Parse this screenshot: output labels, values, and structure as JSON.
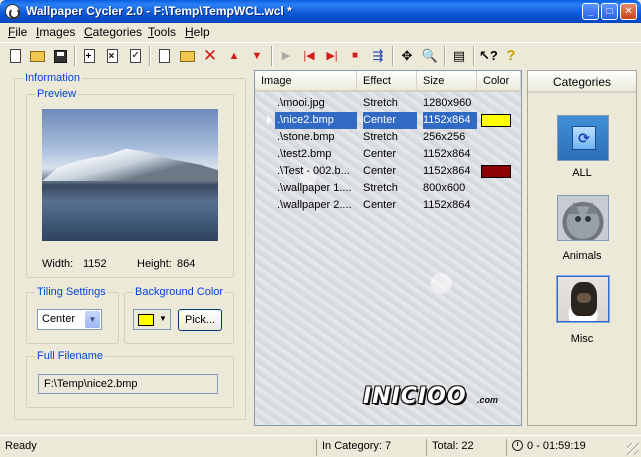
{
  "window": {
    "title": "Wallpaper Cycler 2.0 - F:\\Temp\\TempWCL.wcl *",
    "min": "_",
    "max": "□",
    "close": "✕"
  },
  "menu": {
    "file": {
      "u": "F",
      "rest": "ile"
    },
    "images": {
      "u": "I",
      "rest": "mages"
    },
    "categories": {
      "u": "C",
      "rest": "ategories"
    },
    "tools": {
      "u": "T",
      "rest": "ools"
    },
    "help": {
      "u": "H",
      "rest": "elp"
    }
  },
  "toolbar": {
    "icons": [
      "new-doc",
      "open-folder",
      "save-disk",
      "add-image",
      "delete-image",
      "checklist",
      "new-category",
      "add-folder",
      "delete-x",
      "move-up",
      "move-down",
      "play",
      "first",
      "last",
      "stop",
      "export",
      "settings",
      "preview",
      "properties",
      "context-help",
      "help"
    ]
  },
  "info": {
    "group_label": "Information",
    "preview_label": "Preview",
    "width_label": "Width:",
    "width_value": "1152",
    "height_label": "Height:",
    "height_value": "864",
    "tiling_label": "Tiling Settings",
    "tiling_value": "Center",
    "bg_color_label": "Background Color",
    "bg_color": "#ffff00",
    "pick_label": "Pick...",
    "filename_label": "Full Filename",
    "filename_value": "F:\\Temp\\nice2.bmp"
  },
  "image_list": {
    "columns": [
      "Image",
      "Effect",
      "Size",
      "Color"
    ],
    "rows": [
      {
        "image": ".\\mooi.jpg",
        "effect": "Stretch",
        "size": "1280x960",
        "color": null
      },
      {
        "image": ".\\nice2.bmp",
        "effect": "Center",
        "size": "1152x864",
        "color": "#ffff00",
        "selected": true
      },
      {
        "image": ".\\stone.bmp",
        "effect": "Stretch",
        "size": "256x256",
        "color": null
      },
      {
        "image": ".\\test2.bmp",
        "effect": "Center",
        "size": "1152x864",
        "color": null
      },
      {
        "image": ".\\Test - 002.b...",
        "effect": "Center",
        "size": "1152x864",
        "color": "#8b0000"
      },
      {
        "image": ".\\wallpaper 1....",
        "effect": "Stretch",
        "size": "800x600",
        "color": null
      },
      {
        "image": ".\\wallpaper 2....",
        "effect": "Center",
        "size": "1152x864",
        "color": null
      }
    ],
    "logo": "INICIOO",
    "logo_sub": ".com"
  },
  "categories": {
    "header": "Categories",
    "items": [
      {
        "name": "ALL",
        "icon": "refresh-icon"
      },
      {
        "name": "Animals",
        "icon": "kitten-photo"
      },
      {
        "name": "Misc",
        "icon": "toy-photo",
        "selected": true
      }
    ]
  },
  "status": {
    "ready": "Ready",
    "in_category": "In Category: 7",
    "total": "Total: 22",
    "timer": "0 - 01:59:19"
  },
  "colors": {
    "selection": "#316ac5",
    "group_label": "#0046d5"
  }
}
